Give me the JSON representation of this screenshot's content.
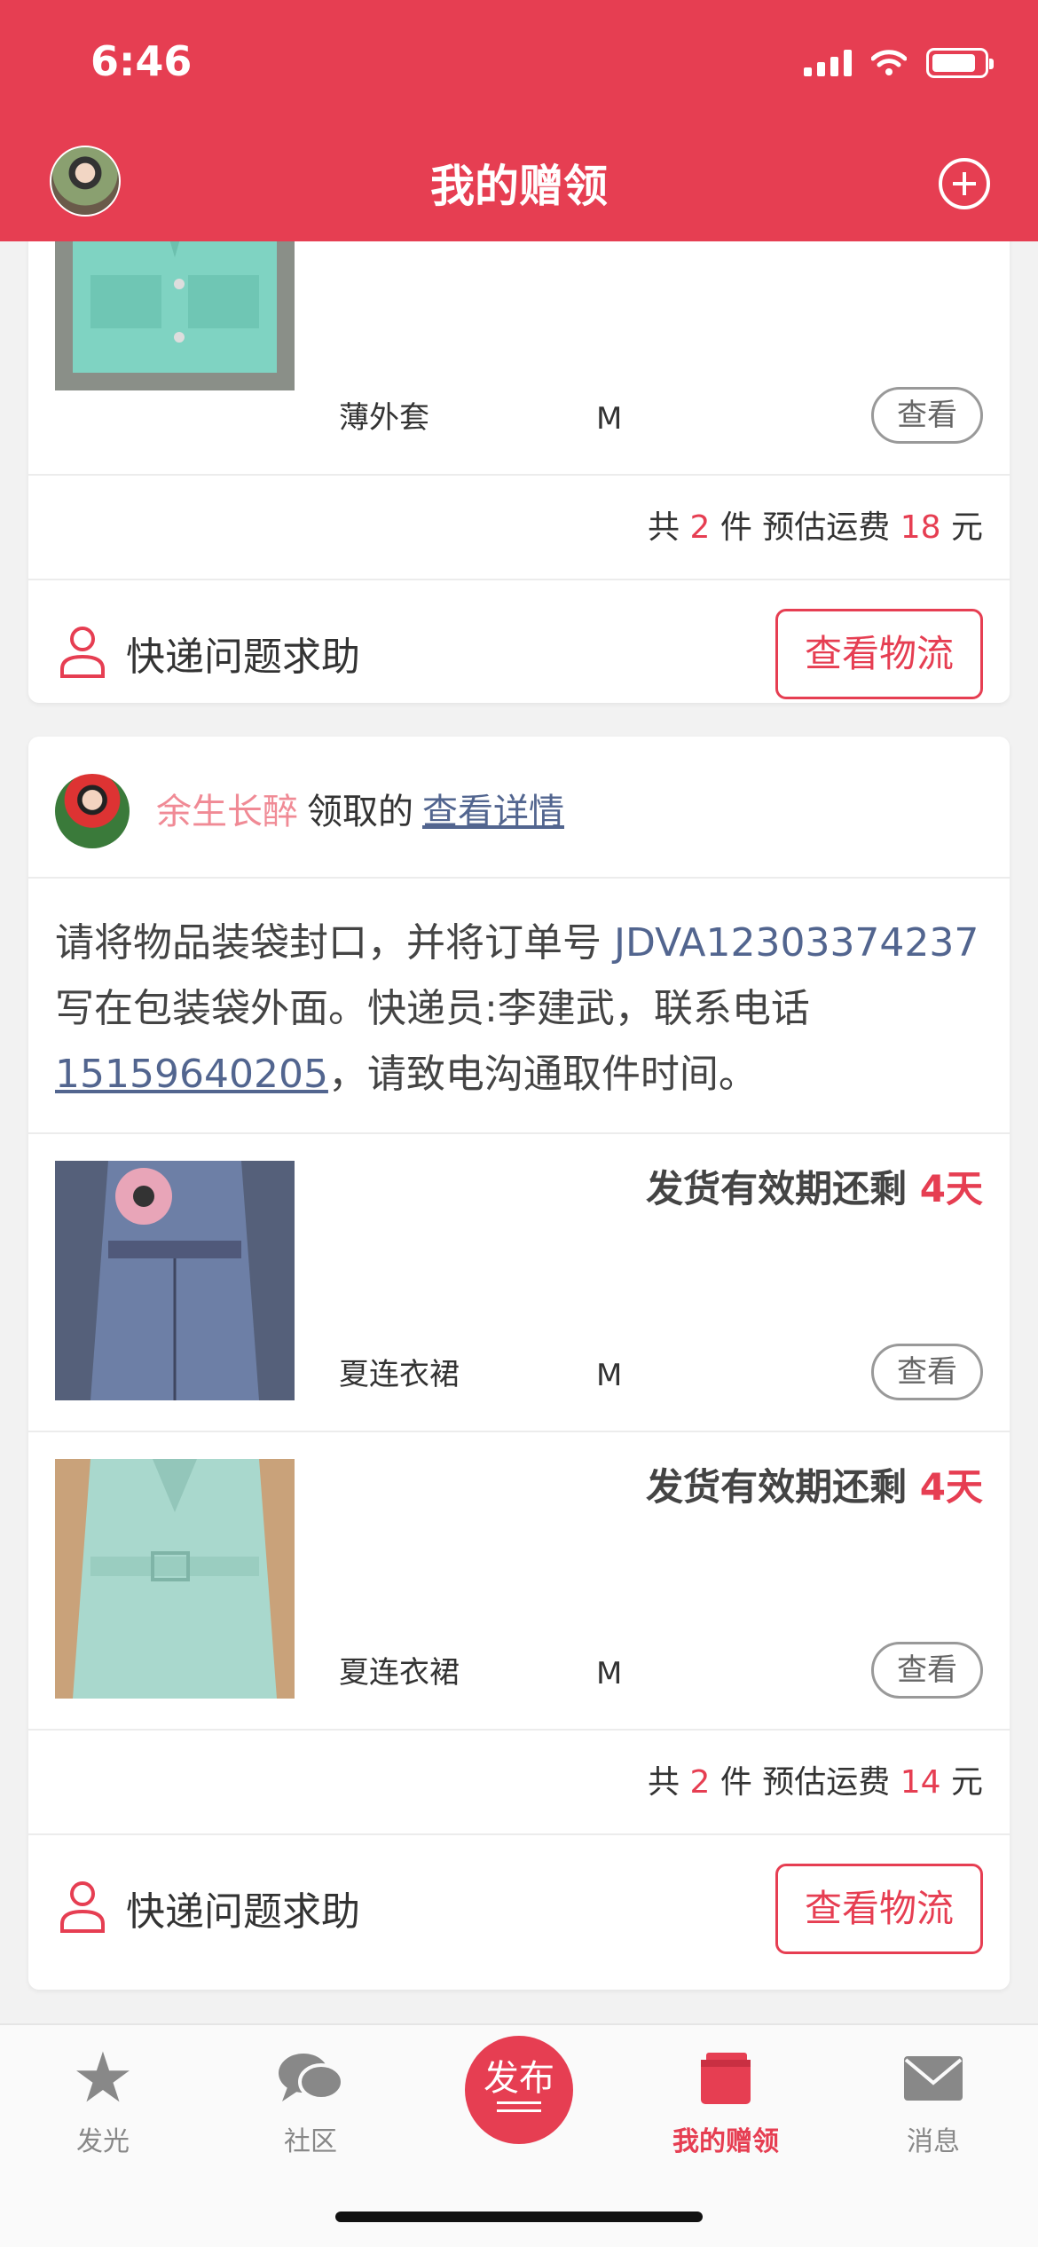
{
  "status_bar": {
    "time": "6:46"
  },
  "header": {
    "title": "我的赠领"
  },
  "card1": {
    "items": [
      {
        "name": "薄外套",
        "size": "M",
        "view_label": "查看",
        "image_icon": "mint-jacket-photo"
      }
    ],
    "summary": {
      "prefix": "共",
      "count": "2",
      "mid": "件 预估运费",
      "fee": "18",
      "suffix": "元"
    },
    "help_label": "快递问题求助",
    "logistics_label": "查看物流"
  },
  "card2": {
    "claimer": {
      "name": "余生长醉",
      "verb": "领取的",
      "detail_link": "查看详情"
    },
    "instructions": {
      "part1": "请将物品装袋封口，并将订单号 ",
      "order_no": "JDVA12303374237",
      "part2": " 写在包装袋外面。快递员:李建武，联系电话 ",
      "phone": "15159640205",
      "part3": "，请致电沟通取件时间。"
    },
    "items": [
      {
        "deadline_prefix": "发货有效期还剩 ",
        "days": "4天",
        "name": "夏连衣裙",
        "size": "M",
        "view_label": "查看",
        "image_icon": "denim-dress-photo"
      },
      {
        "deadline_prefix": "发货有效期还剩 ",
        "days": "4天",
        "name": "夏连衣裙",
        "size": "M",
        "view_label": "查看",
        "image_icon": "mint-dress-photo"
      }
    ],
    "summary": {
      "prefix": "共",
      "count": "2",
      "mid": "件 预估运费",
      "fee": "14",
      "suffix": "元"
    },
    "help_label": "快递问题求助",
    "logistics_label": "查看物流"
  },
  "tabbar": {
    "tabs": [
      {
        "label": "发光",
        "icon": "star-icon"
      },
      {
        "label": "社区",
        "icon": "chat-bubble-icon"
      },
      {
        "label": "发布",
        "icon": "publish-icon"
      },
      {
        "label": "我的赠领",
        "icon": "gift-box-icon",
        "active": true
      },
      {
        "label": "消息",
        "icon": "mail-icon"
      }
    ]
  },
  "colors": {
    "brand_red": "#e63e52",
    "link_blue": "#52658f"
  }
}
